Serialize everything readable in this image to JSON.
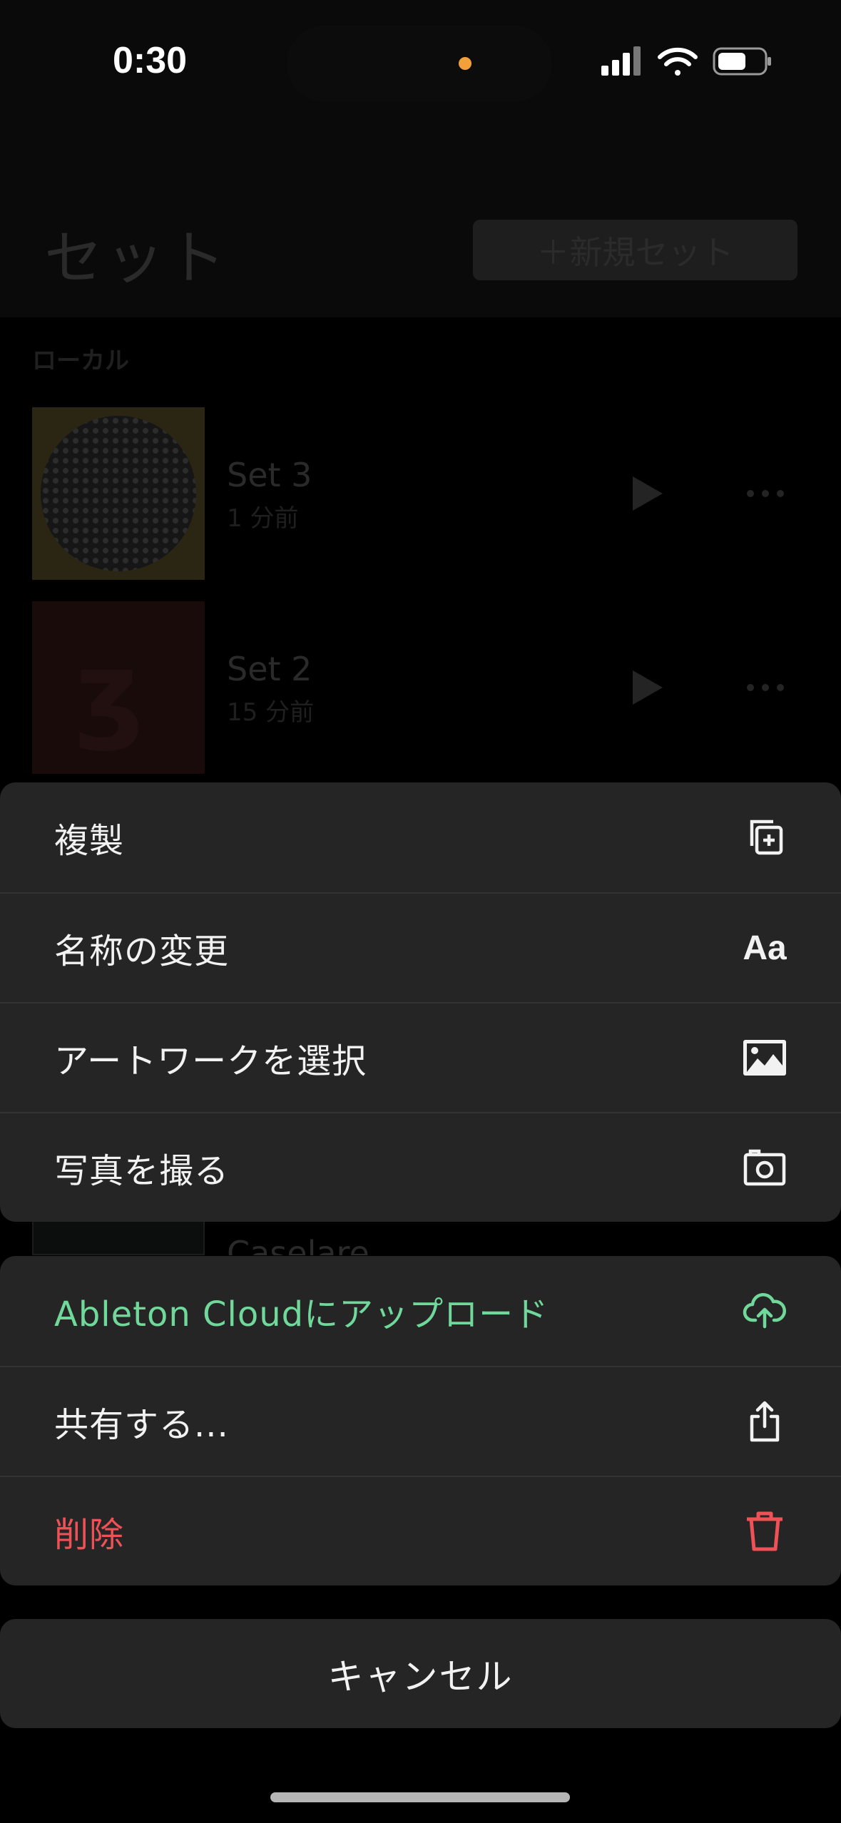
{
  "status_bar": {
    "time": "0:30"
  },
  "header": {
    "title": "セット",
    "new_set_label": "＋新規セット"
  },
  "section": {
    "label": "ローカル"
  },
  "sets": [
    {
      "name": "Set 3",
      "time": "1 分前"
    },
    {
      "name": "Set 2",
      "time": "15 分前"
    },
    {
      "name": "Caselare"
    }
  ],
  "action_sheet": {
    "group1": [
      {
        "label": "複製",
        "icon": "duplicate-icon"
      },
      {
        "label": "名称の変更",
        "icon": "rename-icon",
        "icon_text": "Aa"
      },
      {
        "label": "アートワークを選択",
        "icon": "image-icon"
      },
      {
        "label": "写真を撮る",
        "icon": "camera-icon"
      }
    ],
    "group2": [
      {
        "label": "Ableton Cloudにアップロード",
        "icon": "cloud-upload-icon",
        "color": "#6fd89a"
      },
      {
        "label": "共有する...",
        "icon": "share-icon"
      },
      {
        "label": "削除",
        "icon": "trash-icon",
        "color": "#ee5156"
      }
    ],
    "cancel_label": "キャンセル"
  },
  "colors": {
    "accent_green": "#6fd89a",
    "destructive_red": "#ee5156",
    "sheet_background": "#252525"
  }
}
